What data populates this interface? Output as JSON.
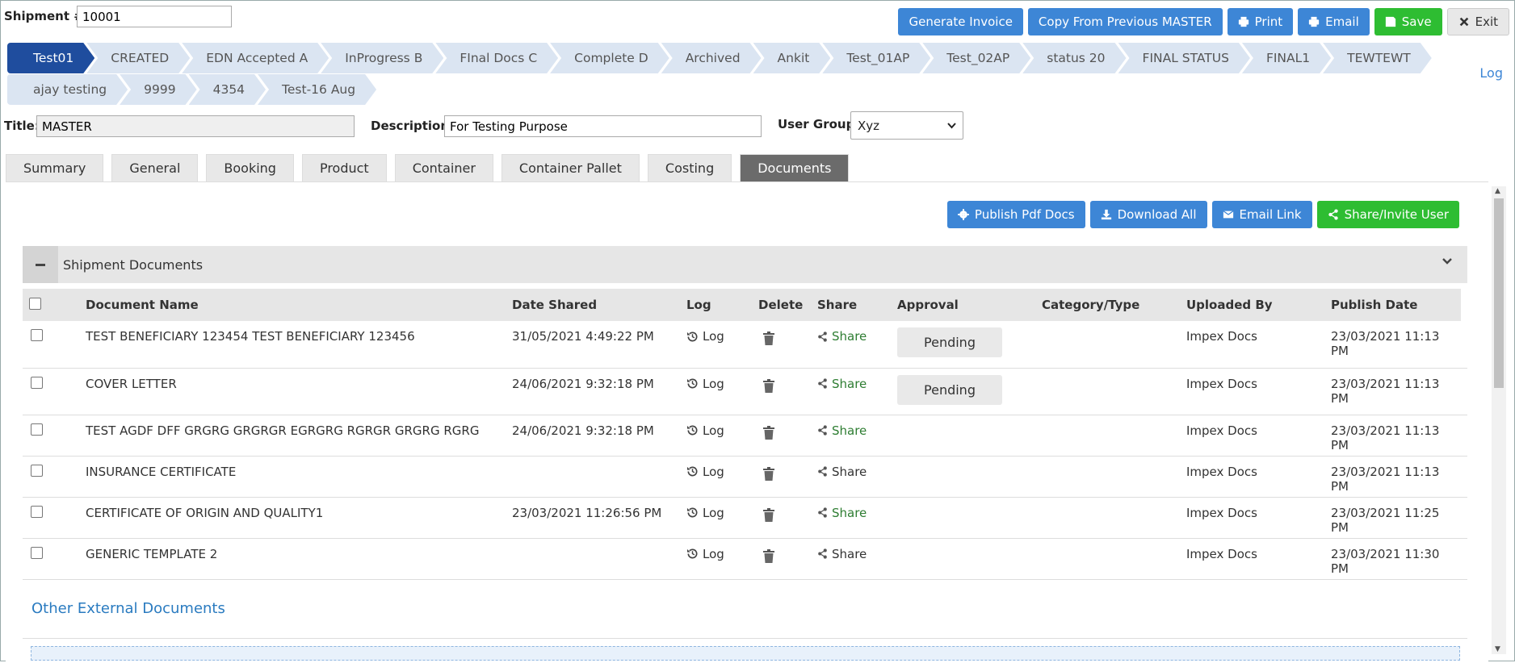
{
  "header": {
    "shipment_label": "Shipment #:",
    "shipment_value": "10001",
    "buttons": {
      "generate_invoice": "Generate Invoice",
      "copy_previous": "Copy From Previous MASTER",
      "print": "Print",
      "email": "Email",
      "save": "Save",
      "exit": "Exit"
    }
  },
  "statuses_row1": [
    "Test01",
    "CREATED",
    "EDN Accepted A",
    "InProgress B",
    "FInal Docs C",
    "Complete D",
    "Archived",
    "Ankit",
    "Test_01AP",
    "Test_02AP",
    "status 20",
    "FINAL STATUS",
    "FINAL1",
    "TEWTEWT"
  ],
  "statuses_row2": [
    "ajay testing",
    "9999",
    "4354",
    "Test-16 Aug"
  ],
  "log_link": "Log",
  "form": {
    "title_label": "Title:",
    "title_value": "MASTER",
    "description_label": "Description:",
    "description_value": "For Testing Purpose",
    "user_group_label": "User Group:",
    "user_group_value": "Xyz"
  },
  "tabs": [
    "Summary",
    "General",
    "Booking",
    "Product",
    "Container",
    "Container Pallet",
    "Costing",
    "Documents"
  ],
  "actions": {
    "publish": "Publish Pdf Docs",
    "download_all": "Download All",
    "email_link": "Email Link",
    "share_invite": "Share/Invite User"
  },
  "section": {
    "title": "Shipment Documents"
  },
  "table": {
    "headers": [
      "Document Name",
      "Date Shared",
      "Log",
      "Delete",
      "Share",
      "Approval",
      "Category/Type",
      "Uploaded By",
      "Publish Date"
    ],
    "rows": [
      {
        "name": "TEST BENEFICIARY 123454 TEST BENEFICIARY 123456",
        "date": "31/05/2021 4:49:22 PM",
        "log": "Log",
        "share": "Share",
        "approval": "Pending",
        "category": "",
        "uploaded_by": "Impex Docs",
        "publish": "23/03/2021 11:13 PM"
      },
      {
        "name": "COVER LETTER",
        "date": "24/06/2021 9:32:18 PM",
        "log": "Log",
        "share": "Share",
        "approval": "Pending",
        "category": "",
        "uploaded_by": "Impex Docs",
        "publish": "23/03/2021 11:13 PM"
      },
      {
        "name": "TEST AGDF DFF GRGRG GRGRGR EGRGRG RGRGR GRGRG RGRG",
        "date": "24/06/2021 9:32:18 PM",
        "log": "Log",
        "share": "Share",
        "approval": "",
        "category": "",
        "uploaded_by": "Impex Docs",
        "publish": "23/03/2021 11:13 PM"
      },
      {
        "name": "INSURANCE CERTIFICATE",
        "date": "",
        "log": "Log",
        "share": "Share",
        "approval": "",
        "category": "",
        "uploaded_by": "Impex Docs",
        "publish": "23/03/2021 11:13 PM"
      },
      {
        "name": "CERTIFICATE OF ORIGIN AND QUALITY1",
        "date": "23/03/2021 11:26:56 PM",
        "log": "Log",
        "share": "Share",
        "approval": "",
        "category": "",
        "uploaded_by": "Impex Docs",
        "publish": "23/03/2021 11:25 PM"
      },
      {
        "name": "GENERIC TEMPLATE 2",
        "date": "",
        "log": "Log",
        "share": "Share",
        "approval": "",
        "category": "",
        "uploaded_by": "Impex Docs",
        "publish": "23/03/2021 11:30 PM"
      }
    ]
  },
  "other_section": {
    "title": "Other External Documents"
  },
  "colors": {
    "primary_blue": "#3d86d6",
    "green": "#2ebd32",
    "active_status": "#1f4d9e",
    "status_bg": "#dbe5f2",
    "link_blue": "#2a7bc0"
  },
  "icons": [
    "print-icon",
    "email-icon",
    "save-icon",
    "close-icon",
    "gear-icon",
    "download-icon",
    "envelope-icon",
    "share-icon",
    "history-icon",
    "trash-icon",
    "chevron-down-icon",
    "minus-icon"
  ]
}
